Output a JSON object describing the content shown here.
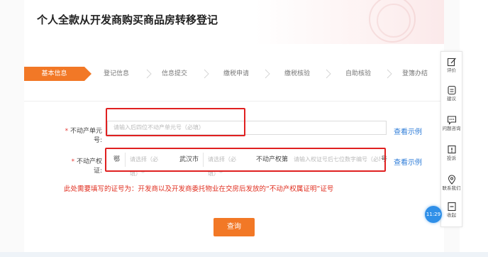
{
  "header": {
    "title": "个人全款从开发商购买商品房转移登记"
  },
  "steps": [
    {
      "label": "基本信息",
      "active": true
    },
    {
      "label": "登记信息",
      "active": false
    },
    {
      "label": "信息提交",
      "active": false
    },
    {
      "label": "缴税申请",
      "active": false
    },
    {
      "label": "缴税核验",
      "active": false
    },
    {
      "label": "自助核验",
      "active": false
    },
    {
      "label": "登簿办结",
      "active": false
    }
  ],
  "form": {
    "unit_no": {
      "required_mark": "*",
      "label": "不动产单元号:",
      "placeholder": "请输入后四位不动产单元号（必填）",
      "example_link": "查看示例"
    },
    "cert_no": {
      "required_mark": "*",
      "label": "不动产权证:",
      "prefix": "鄂",
      "year_select_placeholder": "请选择（必填）",
      "city": "武汉市",
      "type_select_placeholder": "请选择（必填）",
      "cert_word": "不动产权第",
      "number_placeholder": "请输入权证号后七位数字编号（必填）",
      "suffix": "号",
      "example_link": "查看示例"
    },
    "warning": "此处需要填写的证号为：开发商以及开发商委托物业在交房后发放的“不动产权属证明”证号",
    "submit_label": "查询"
  },
  "sidebar": {
    "items": [
      {
        "label": "评价",
        "icon": "edit-icon"
      },
      {
        "label": "建议",
        "icon": "suggestion-icon"
      },
      {
        "label": "问题咨询",
        "icon": "chat-icon"
      },
      {
        "label": "投诉",
        "icon": "complaint-icon"
      },
      {
        "label": "联系我们",
        "icon": "location-icon"
      },
      {
        "label": "收起",
        "icon": "collapse-icon"
      }
    ],
    "time_badge": "11:29"
  },
  "colors": {
    "accent": "#f27826",
    "alert": "#e02020",
    "link": "#2f7dd8"
  }
}
